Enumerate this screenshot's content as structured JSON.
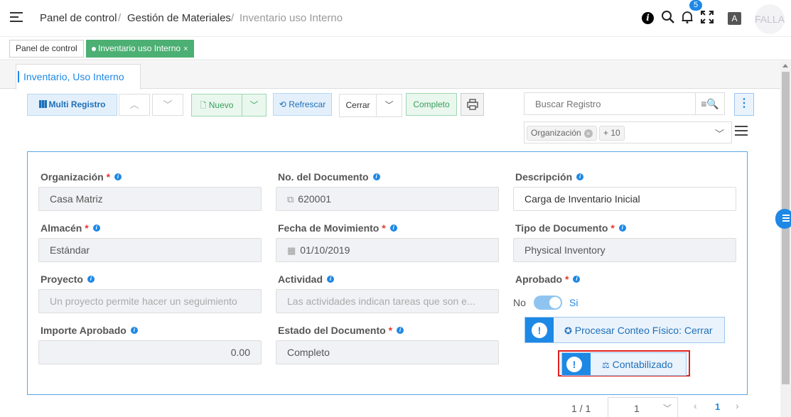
{
  "breadcrumb": [
    "Panel de control",
    "Gestión de Materiales",
    "Inventario uso Interno"
  ],
  "breadcrumb_sep": "/",
  "header": {
    "notifications_count": "5",
    "avatar_text": "FALLA",
    "info_glyph": "i",
    "translate_glyph": "A",
    "icons": [
      "info-icon",
      "search-icon",
      "bell-icon",
      "fullscreen-icon",
      "translate-icon"
    ]
  },
  "tabs": [
    {
      "label": "Panel de control",
      "active": false
    },
    {
      "label": "Inventario uso Interno",
      "active": true,
      "close": "×"
    }
  ],
  "window_tab": "Inventario, Uso Interno",
  "toolbar": {
    "multi_registro": "Multi Registro",
    "nuevo": "Nuevo",
    "refrescar": "Refrescar",
    "cerrar": "Cerrar",
    "completo": "Completo",
    "search_placeholder": "Buscar Registro",
    "filter_chip": "Organización",
    "filter_more": "+ 10"
  },
  "form": {
    "organizacion": {
      "label": "Organización",
      "required": true,
      "value": "Casa Matriz"
    },
    "no_documento": {
      "label": "No. del Documento",
      "required": false,
      "value": "620001"
    },
    "descripcion": {
      "label": "Descripción",
      "required": false,
      "value": "Carga de Inventario Inicial"
    },
    "almacen": {
      "label": "Almacén",
      "required": true,
      "value": "Estándar"
    },
    "fecha_movimiento": {
      "label": "Fecha de Movimiento",
      "required": true,
      "value": "01/10/2019"
    },
    "tipo_documento": {
      "label": "Tipo de Documento",
      "required": true,
      "value": "Physical Inventory"
    },
    "proyecto": {
      "label": "Proyecto",
      "required": false,
      "placeholder": "Un proyecto permite hacer un seguimiento"
    },
    "actividad": {
      "label": "Actividad",
      "required": false,
      "placeholder": "Las actividades indican tareas que son e..."
    },
    "aprobado": {
      "label": "Aprobado",
      "required": true,
      "off_label": "No",
      "on_label": "Si",
      "value": true
    },
    "importe_aprobado": {
      "label": "Importe Aprobado",
      "required": false,
      "value": "0.00"
    },
    "estado_documento": {
      "label": "Estado del Documento",
      "required": true,
      "value": "Completo"
    },
    "procesar_button": "Procesar Conteo Físico: Cerrar",
    "contabilizado_button": "Contabilizado",
    "required_mark": "*",
    "exclamation": "!"
  },
  "pagination": {
    "count": "1 / 1",
    "page_select": "1",
    "current_page": "1"
  },
  "colors": {
    "accent": "#1e88e5",
    "success": "#36a05a",
    "highlight": "#e02020"
  }
}
